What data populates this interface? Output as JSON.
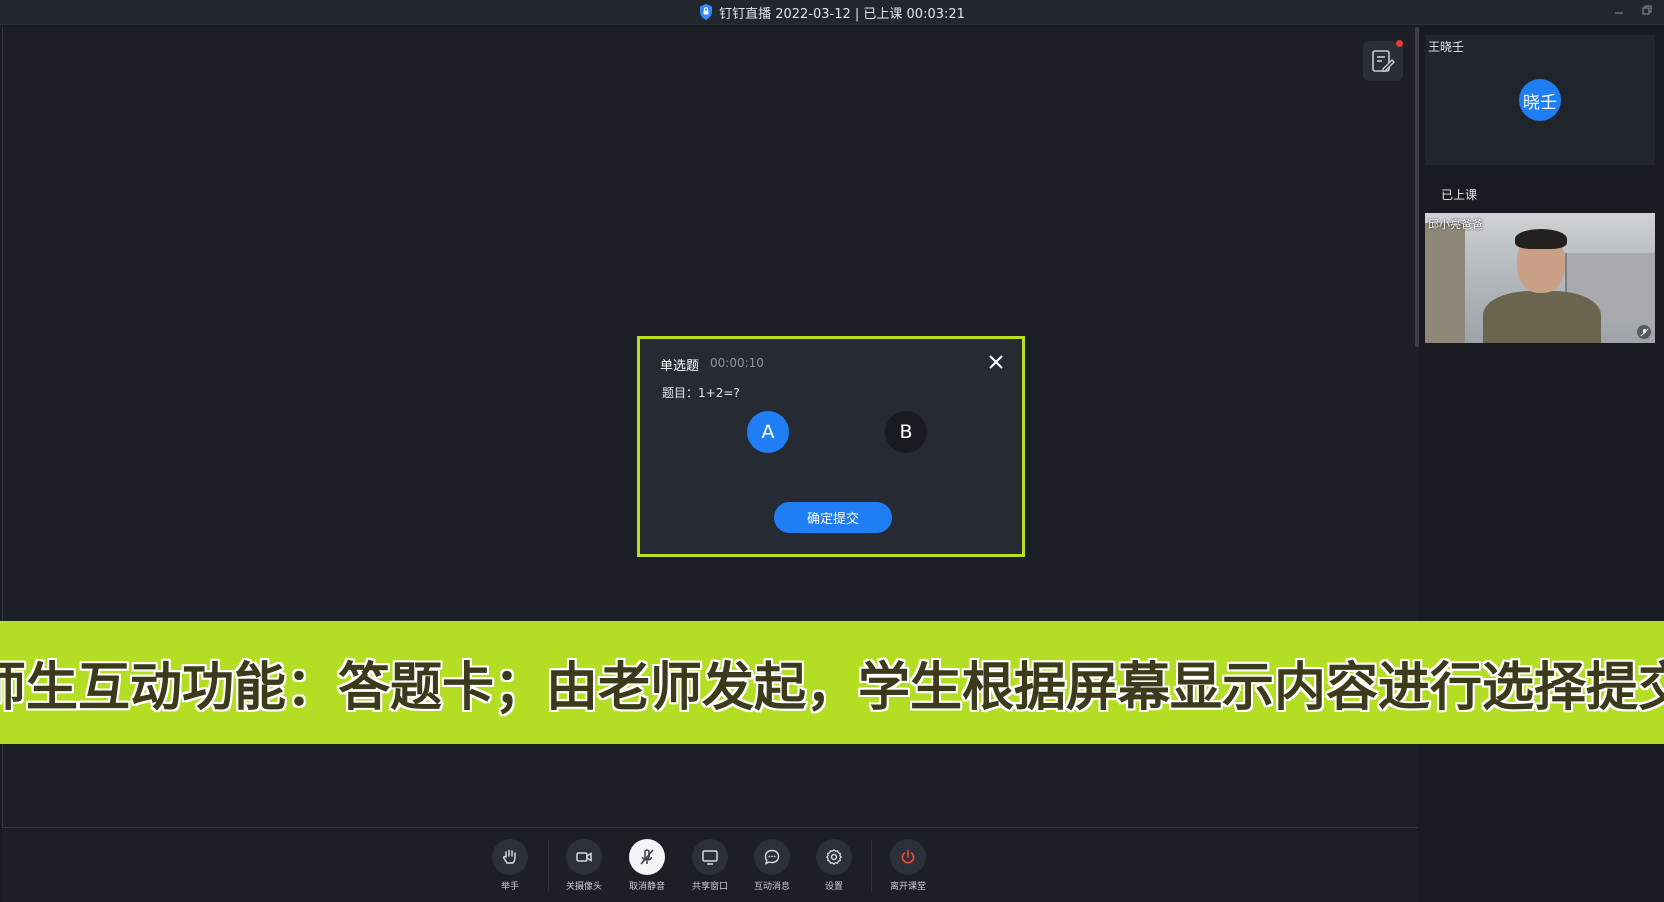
{
  "window": {
    "title": "钉钉直播 2022-03-12 | 已上课 00:03:21"
  },
  "sidebar": {
    "top_participant": {
      "name": "王晓壬",
      "avatar_text": "晓壬"
    },
    "status_label": "已上课",
    "video_participant": {
      "name": "邱小亮爸爸"
    }
  },
  "dialog": {
    "title": "单选题",
    "timer": "00:00:10",
    "question": "题目：1+2=?",
    "options": [
      "A",
      "B"
    ],
    "selected_option": "A",
    "submit_label": "确定提交"
  },
  "banner": {
    "text": "师生互动功能：答题卡；由老师发起，学生根据屏幕显示内容进行选择提交"
  },
  "toolbar": {
    "items": [
      {
        "label": "举手",
        "icon": "raise-hand-icon"
      },
      {
        "label": "关摄像头",
        "icon": "camera-icon"
      },
      {
        "label": "取消静音",
        "icon": "mic-muted-icon",
        "active": true
      },
      {
        "label": "共享窗口",
        "icon": "screen-share-icon"
      },
      {
        "label": "互动消息",
        "icon": "chat-icon"
      },
      {
        "label": "设置",
        "icon": "gear-icon"
      },
      {
        "label": "离开课堂",
        "icon": "power-icon"
      }
    ]
  },
  "colors": {
    "accent": "#1f7ef3",
    "banner": "#b3de24",
    "dialog_border": "#b7e021",
    "leave": "#e8493a"
  }
}
